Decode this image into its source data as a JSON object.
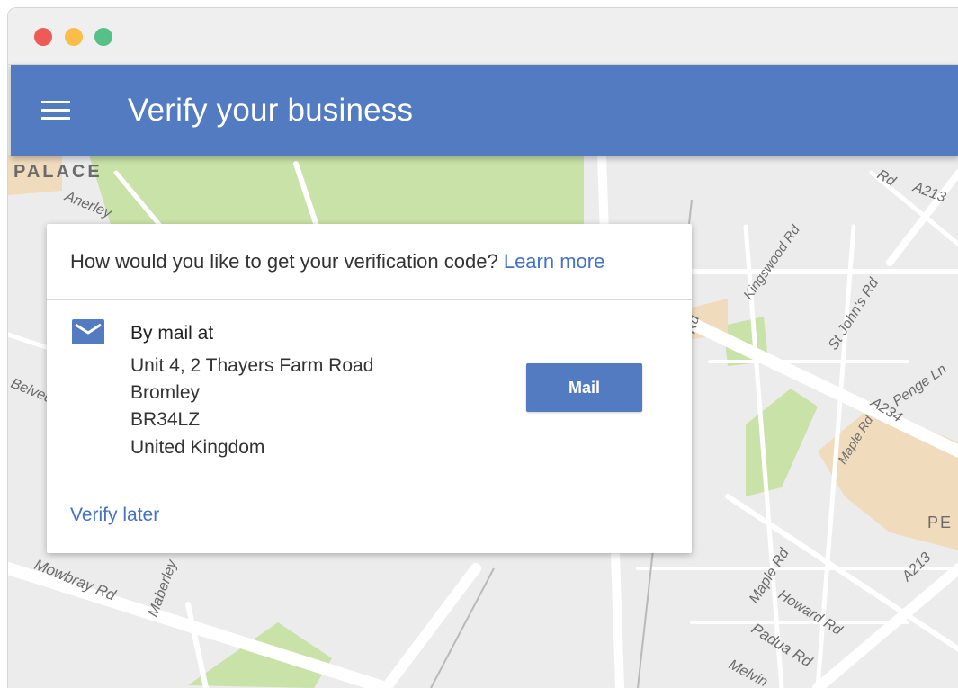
{
  "window": {
    "traffic_lights": [
      "#ee5b56",
      "#fbbd4a",
      "#56c187"
    ]
  },
  "appbar": {
    "menu_icon": "hamburger-menu-icon",
    "title": "Verify your business",
    "color": "#527bc1"
  },
  "card": {
    "question": "How would you like to get your verification code?",
    "learn_more": "Learn more",
    "method": {
      "icon": "mail-envelope-icon",
      "title": "By mail at",
      "address_lines": [
        "Unit 4, 2 Thayers Farm Road",
        "Bromley",
        "BR34LZ",
        "United Kingdom"
      ],
      "button_label": "Mail"
    },
    "verify_later": "Verify later"
  },
  "map": {
    "labels": [
      "PALACE",
      "Anerley",
      "Belvedere",
      "Mowbray Rd",
      "Maberley",
      "Kingswood Rd",
      "St John's Rd",
      "Penge Ln",
      "A234",
      "Maple Rd",
      "Maple Rd",
      "Howard Rd",
      "Padua Rd",
      "Melvin",
      "A213",
      "A213",
      "Rd",
      "Rd",
      "PE"
    ]
  }
}
